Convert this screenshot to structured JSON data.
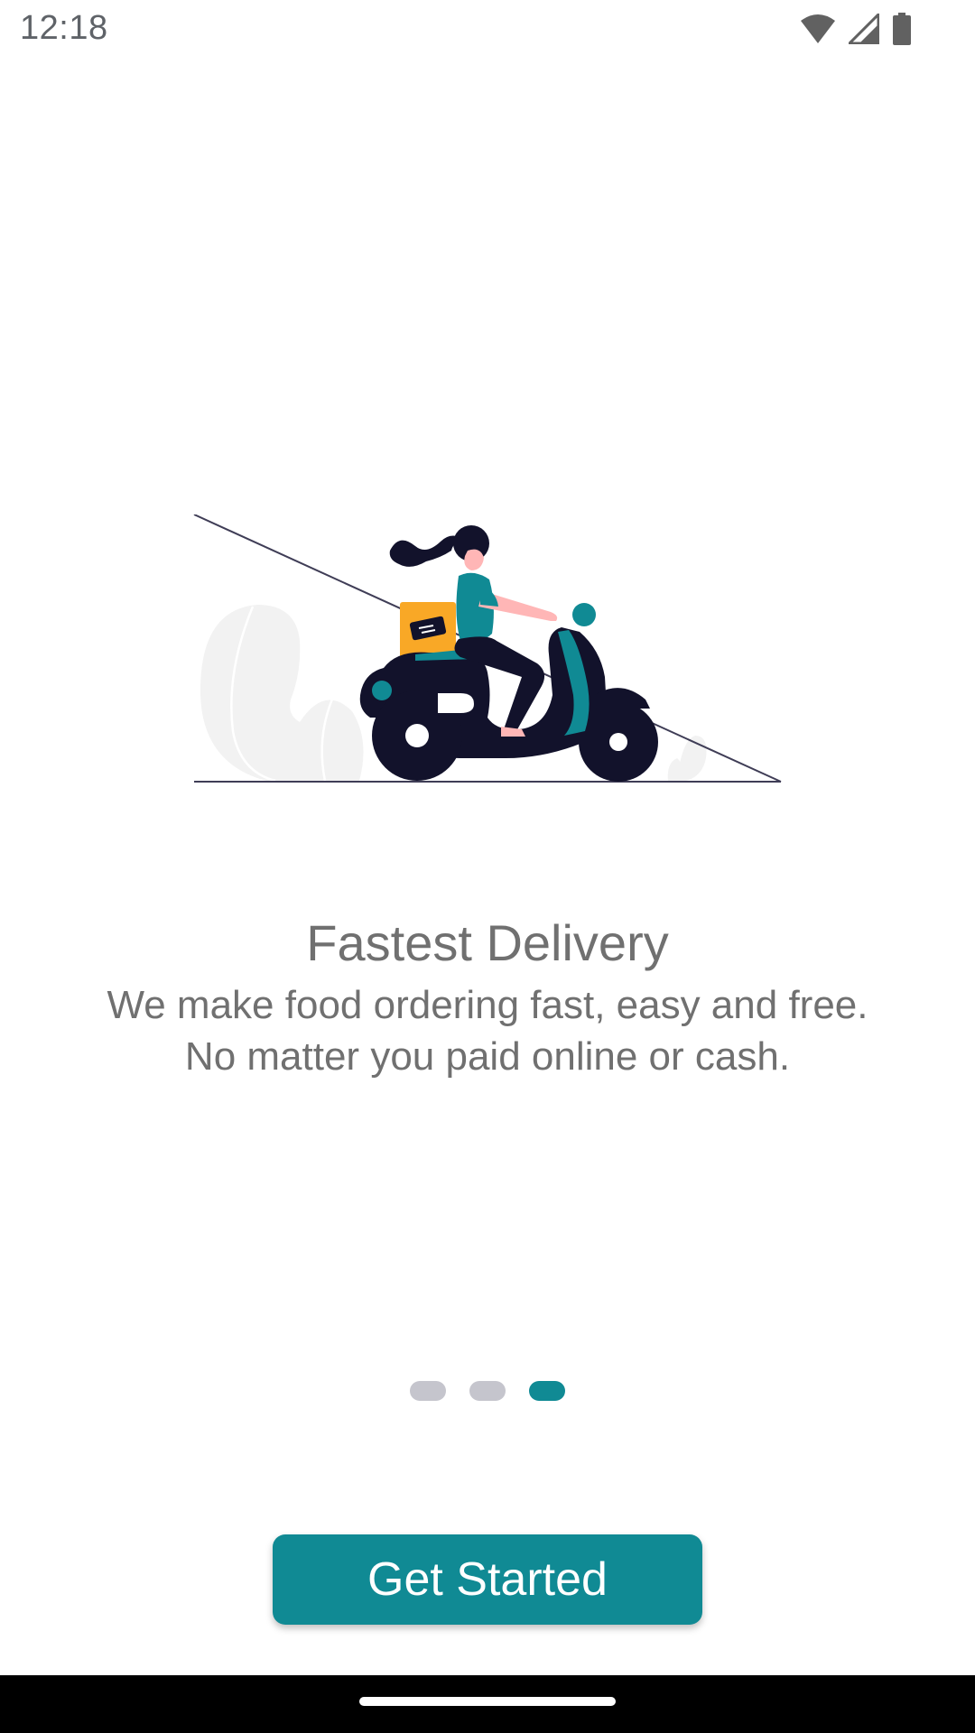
{
  "status_bar": {
    "time": "12:18",
    "icons": [
      "wifi-icon",
      "signal-icon",
      "battery-icon"
    ]
  },
  "onboarding": {
    "illustration": "scooter-delivery-illustration",
    "title": "Fastest Delivery",
    "description_line1": "We make food ordering fast, easy and free.",
    "description_line2": "No matter you paid online or cash.",
    "page_indicator": {
      "total": 3,
      "current": 3
    },
    "cta_label": "Get Started"
  },
  "colors": {
    "accent": "#108a94",
    "dot_inactive": "#c5c5cd",
    "text": "#707070",
    "scooter": "#12122b",
    "box": "#f9a826"
  }
}
